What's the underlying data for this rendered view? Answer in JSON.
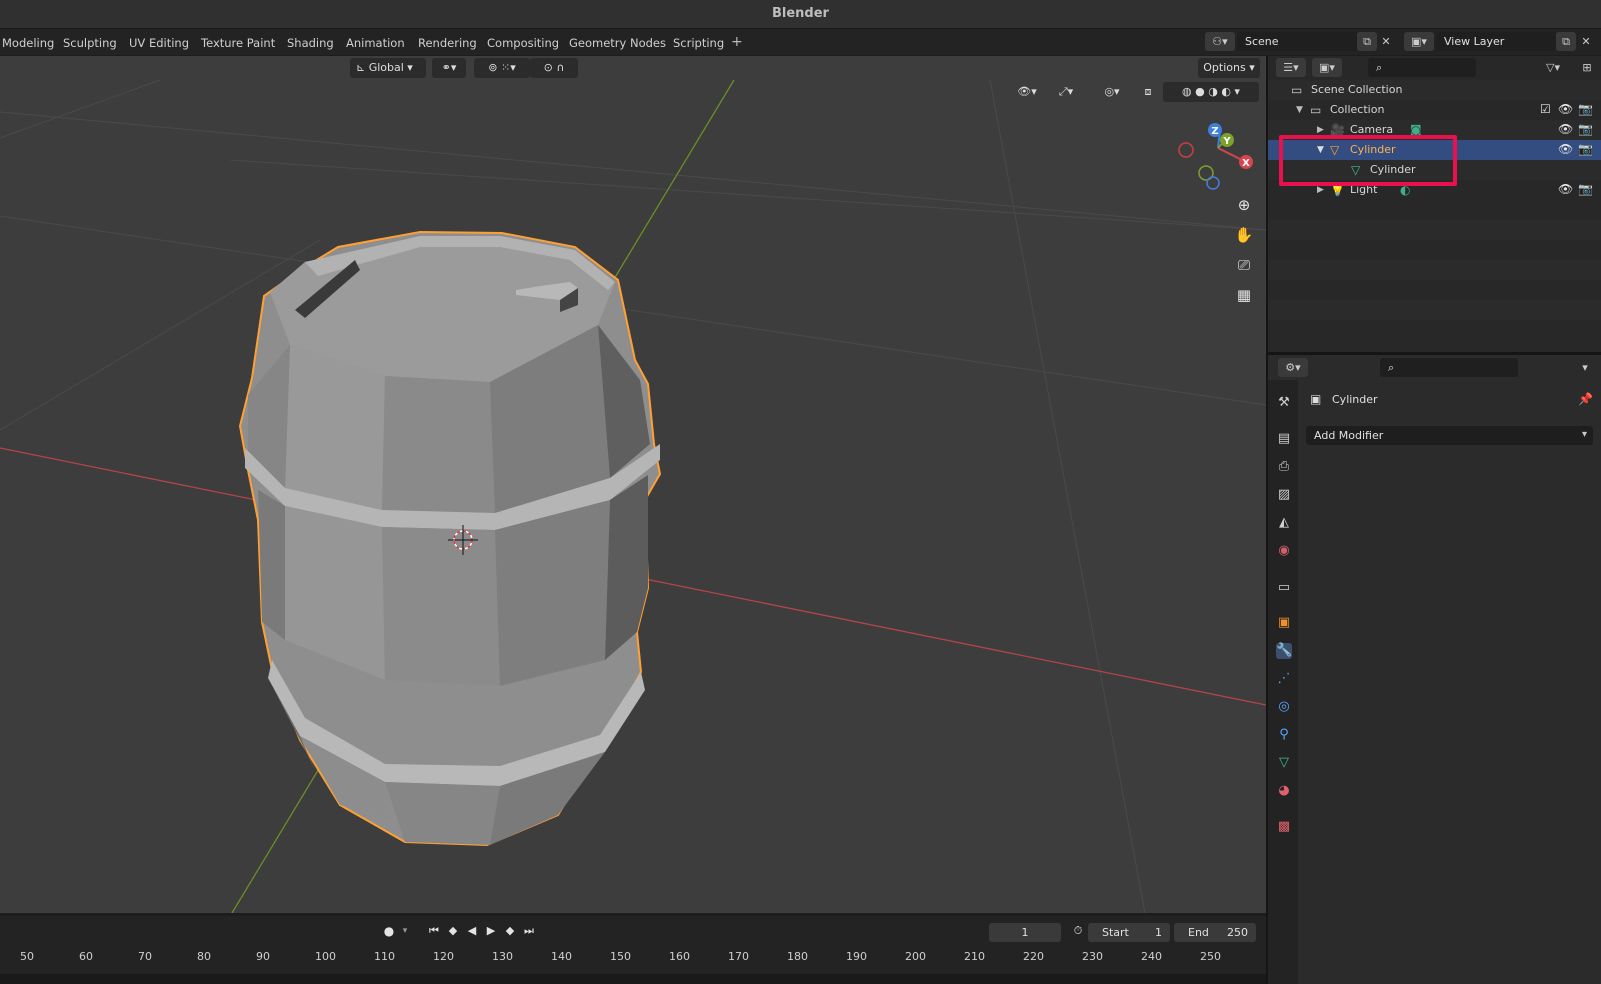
{
  "app": {
    "title": "Blender"
  },
  "workspaces": [
    "Modeling",
    "Sculpting",
    "UV Editing",
    "Texture Paint",
    "Shading",
    "Animation",
    "Rendering",
    "Compositing",
    "Geometry Nodes",
    "Scripting"
  ],
  "scene": {
    "label": "Scene",
    "view_layer": "View Layer"
  },
  "viewport_header": {
    "orientation": "Global",
    "options_label": "Options"
  },
  "outliner": {
    "rows": [
      {
        "label": "Scene Collection",
        "icon": "scene-collection-icon"
      },
      {
        "label": "Collection",
        "icon": "collection-icon"
      },
      {
        "label": "Camera",
        "icon": "camera-object-icon"
      },
      {
        "label": "Cylinder",
        "icon": "mesh-object-icon",
        "selected": true
      },
      {
        "label": "Cylinder",
        "icon": "mesh-data-icon"
      },
      {
        "label": "Light",
        "icon": "light-object-icon"
      }
    ]
  },
  "properties": {
    "object_name": "Cylinder",
    "add_modifier_label": "Add Modifier",
    "active_tab": "modifiers"
  },
  "timeline": {
    "current_frame": "1",
    "start_label": "Start",
    "start_value": "1",
    "end_label": "End",
    "end_value": "250",
    "ruler_ticks": [
      "50",
      "60",
      "70",
      "80",
      "90",
      "100",
      "110",
      "120",
      "130",
      "140",
      "150",
      "160",
      "170",
      "180",
      "190",
      "200",
      "210",
      "220",
      "230",
      "240",
      "250"
    ]
  },
  "colors": {
    "selection_outline": "#ffa034",
    "highlight_box": "#e8114e",
    "outliner_selected": "#334d80",
    "x_axis": "#d8454f",
    "y_axis": "#7da12d",
    "z_axis": "#3f7fe0"
  }
}
